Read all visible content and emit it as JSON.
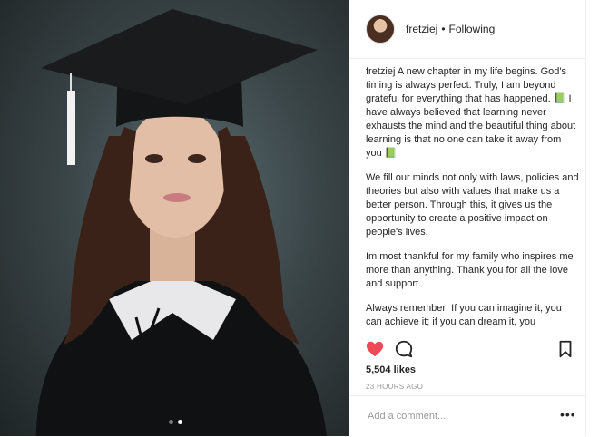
{
  "post": {
    "username": "fretziej",
    "separator": "•",
    "follow_status": "Following",
    "caption_username": "fretziej",
    "caption_paragraphs": [
      "A new chapter in my life begins. God's timing is always perfect. Truly, I am beyond grateful for everything that has happened. 📗 I have always believed that learning never\nexhausts the mind and the beautiful thing about learning is that no one can take it away from you 📗",
      "We fill our minds not only with laws, policies and theories but  also with values that make us a better person. Through this, it gives us the opportunity to create a positive impact on people's lives.",
      "Im most thankful for my family who inspires me more than anything. Thank you for all the love and support.",
      "Always remember: If you can imagine it, you can achieve it; if you can dream it, you"
    ],
    "likes": "5,504 likes",
    "timestamp": "23 HOURS AGO",
    "comment_placeholder": "Add a comment...",
    "more_label": "•••",
    "liked": true,
    "colors": {
      "like": "#ed4956",
      "border": "#efefef",
      "muted": "#999999"
    }
  },
  "carousel": {
    "slides": 2,
    "active": 2
  },
  "icons": [
    "heart-icon",
    "comment-icon",
    "bookmark-icon",
    "more-icon"
  ]
}
